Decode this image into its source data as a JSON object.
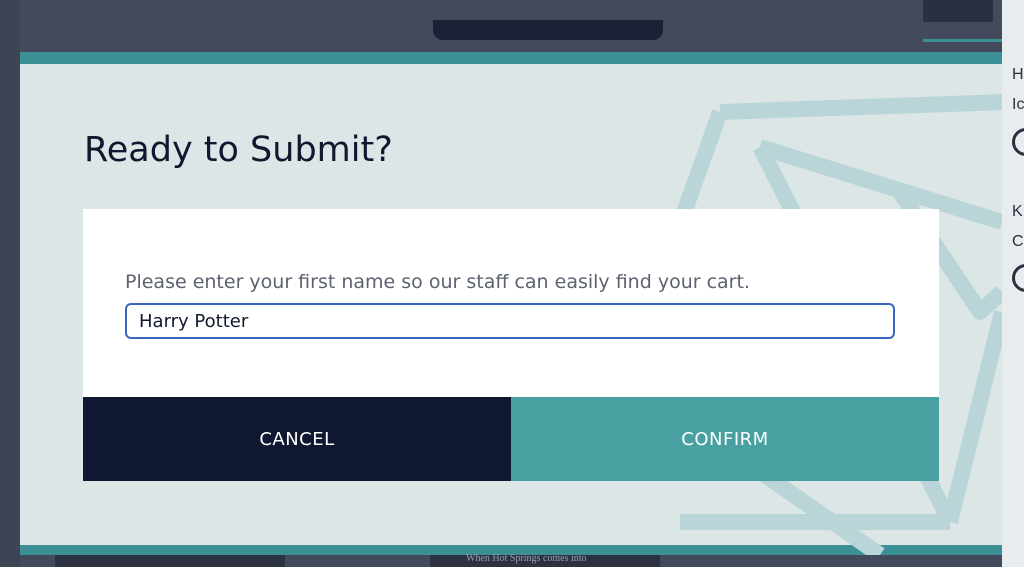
{
  "background": {
    "letters": [
      "H",
      "Ic",
      "K",
      "C"
    ],
    "blurred_caption": "When Hot Springs comes into"
  },
  "modal": {
    "title": "Ready to Submit?",
    "prompt": "Please enter your first name so our staff can easily find your cart.",
    "name_input": {
      "value": "Harry Potter",
      "placeholder": ""
    },
    "cancel_label": "CANCEL",
    "confirm_label": "CONFIRM"
  },
  "colors": {
    "overlay_bg": "#434a5b",
    "modal_bg": "#dce6e7",
    "accent_teal": "#3c8f95",
    "confirm_bg": "#48a0a1",
    "cancel_bg": "#0f1830",
    "title_text": "#101830",
    "input_border": "#3a66c0"
  }
}
